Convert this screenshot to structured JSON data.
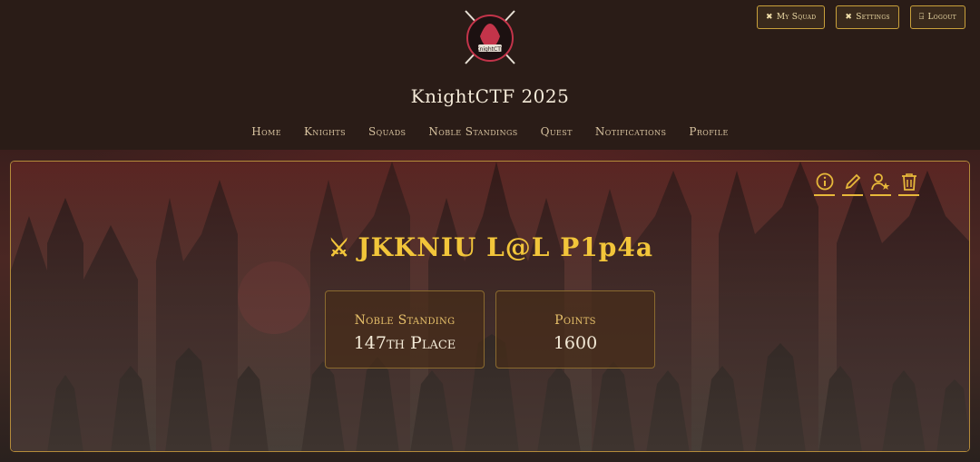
{
  "header": {
    "site_title": "KnightCTF 2025",
    "logo_text": "KnightCTF",
    "actions": [
      {
        "label": "My Squad",
        "icon": "crossed-swords-icon"
      },
      {
        "label": "Settings",
        "icon": "crossed-swords-icon"
      },
      {
        "label": "Logout",
        "icon": "logout-icon"
      }
    ]
  },
  "nav": {
    "items": [
      "Home",
      "Knights",
      "Squads",
      "Noble Standings",
      "Quest",
      "Notifications",
      "Profile"
    ]
  },
  "team": {
    "name": "JKKNIU L@L P1p4a",
    "icon": "crossed-swords-icon"
  },
  "card_actions": [
    "info-icon",
    "edit-icon",
    "user-star-icon",
    "trash-icon"
  ],
  "stats": [
    {
      "label": "Noble Standing",
      "value": "147th Place"
    },
    {
      "label": "Points",
      "value": "1600"
    }
  ],
  "colors": {
    "background": "#2a1c17",
    "accent_gold": "#f2c53a",
    "border_gold": "#b48b3a"
  }
}
